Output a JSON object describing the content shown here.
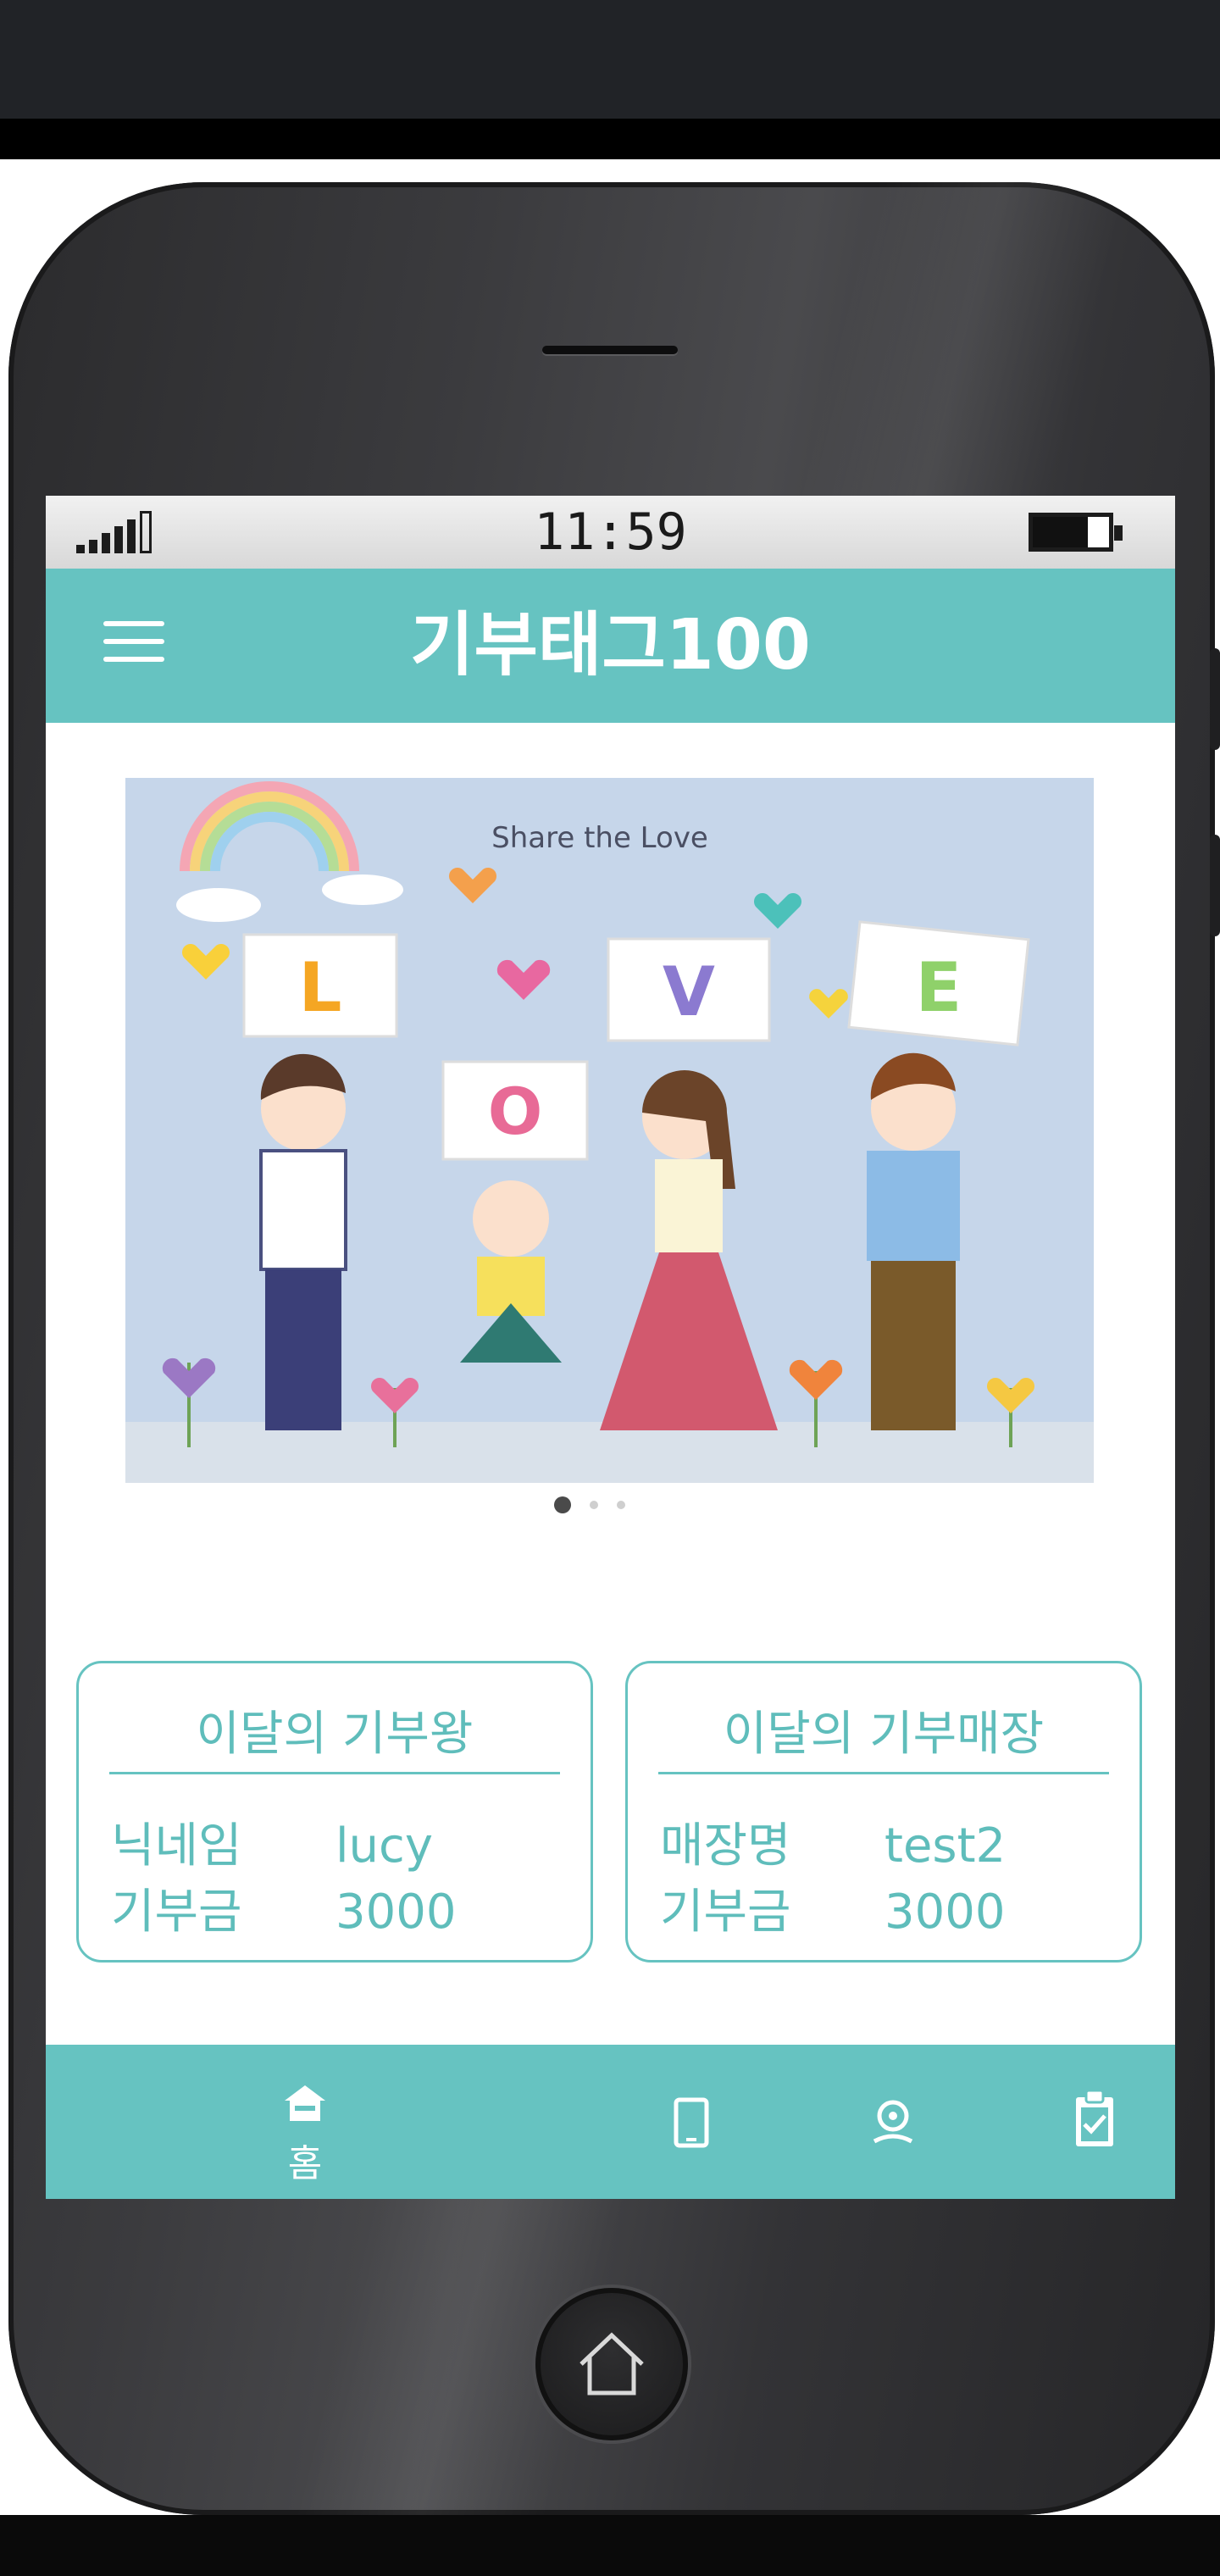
{
  "status_bar": {
    "time": "11:59"
  },
  "app_bar": {
    "title": "기부태그100",
    "menu_icon": "hamburger-menu-icon"
  },
  "banner": {
    "heading": "Share the Love",
    "letters": [
      "L",
      "O",
      "V",
      "E"
    ],
    "slide_count": 3,
    "active_slide": 1
  },
  "cards": [
    {
      "title": "이달의 기부왕",
      "rows": [
        {
          "label": "닉네임",
          "value": "lucy"
        },
        {
          "label": "기부금",
          "value": "3000"
        }
      ]
    },
    {
      "title": "이달의 기부매장",
      "rows": [
        {
          "label": "매장명",
          "value": "test2"
        },
        {
          "label": "기부금",
          "value": "3000"
        }
      ]
    }
  ],
  "bottom_nav": [
    {
      "icon": "home-icon",
      "label": "홈"
    },
    {
      "icon": "mobile-phone-icon",
      "label": ""
    },
    {
      "icon": "location-pin-icon",
      "label": ""
    },
    {
      "icon": "clipboard-check-icon",
      "label": ""
    }
  ],
  "colors": {
    "accent": "#66c3c1",
    "card_text": "#5fbdbb",
    "banner_bg": "#c6d6ea"
  }
}
